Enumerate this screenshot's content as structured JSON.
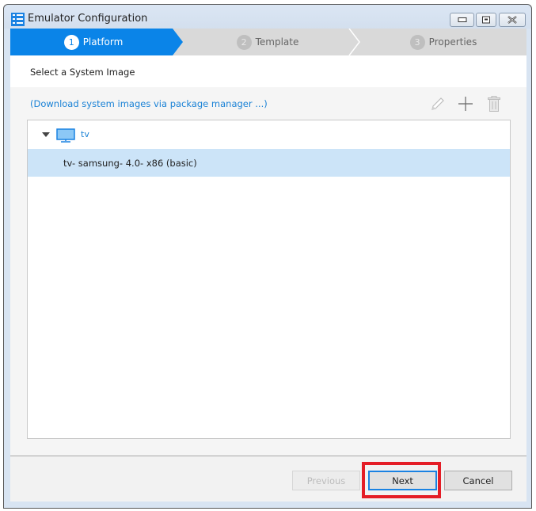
{
  "window": {
    "title": "Emulator Configuration",
    "controls": [
      "minimize-icon",
      "maximize-icon",
      "close-icon"
    ]
  },
  "steps": [
    {
      "number": "1",
      "label": "Platform",
      "state": "active"
    },
    {
      "number": "2",
      "label": "Template",
      "state": "inactive"
    },
    {
      "number": "3",
      "label": "Properties",
      "state": "inactive"
    }
  ],
  "main": {
    "section_title": "Select a System Image",
    "download_link": "(Download system images via package manager ...)",
    "toolbar": [
      "edit-icon",
      "add-icon",
      "delete-icon"
    ],
    "tree": {
      "parent": {
        "label": "tv",
        "icon": "monitor-icon",
        "expanded": true
      },
      "children": [
        {
          "label": "tv- samsung- 4.0- x86 (basic)",
          "selected": true
        }
      ]
    }
  },
  "footer": {
    "previous_label": "Previous",
    "next_label": "Next",
    "cancel_label": "Cancel"
  },
  "colors": {
    "accent": "#0a84e8",
    "link": "#1a82d6",
    "selection": "#cce4f8",
    "highlight_box": "#e41d26"
  }
}
